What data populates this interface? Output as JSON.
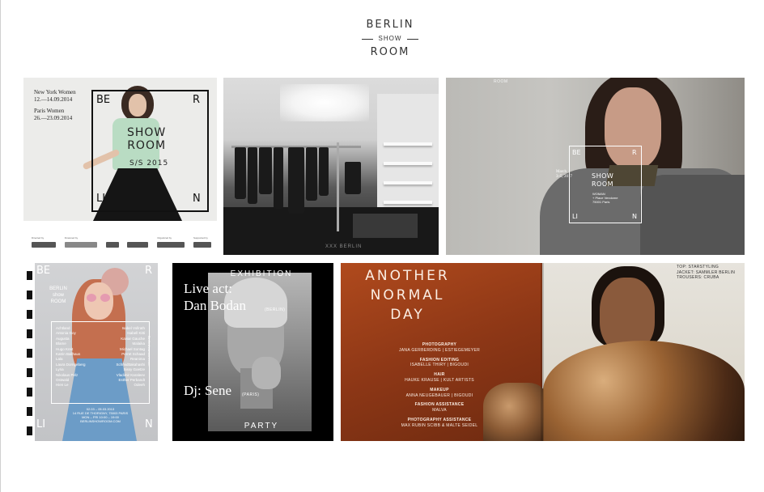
{
  "logo": {
    "line1": "BERLIN",
    "line2": "SHOW",
    "line3": "ROOM"
  },
  "tile1": {
    "dates": [
      "New York Women",
      "12.—14.09.2014",
      "",
      "Paris Women",
      "26.—23.09.2014"
    ],
    "corner_letters": [
      "BE",
      "R",
      "LI",
      "N"
    ],
    "show_lines": [
      "SHOW",
      "ROOM"
    ],
    "season": "S/S 2015",
    "sponsors": [
      {
        "caption": "Directed by",
        "label": "projekt"
      },
      {
        "caption": "Financed by",
        "label": "EU"
      },
      {
        "caption": "",
        "label": "BMWi"
      },
      {
        "caption": "",
        "label": "berlin"
      },
      {
        "caption": "Organized by",
        "label": "IDZ"
      },
      {
        "caption": "Supported by",
        "label": "logo"
      }
    ]
  },
  "tile2": {
    "watermark": "XXX BERLIN"
  },
  "tile3": {
    "tag": "ROOM",
    "corner_letters": [
      "BE",
      "R",
      "LI",
      "N"
    ],
    "show_lines": [
      "SHOW",
      "ROOM"
    ],
    "date_lines": [
      "March",
      "3–5, 2017"
    ],
    "sub_lines": [
      "WOMAN",
      "+ Place Vendome",
      "75001 Paris"
    ]
  },
  "tile4": {
    "corner_letters": [
      "BE",
      "R",
      "LI",
      "N"
    ],
    "logo_lines": [
      "BERLIN",
      "show",
      "ROOM"
    ],
    "list": [
      [
        "Achtland",
        "Isabel Vollrath"
      ],
      [
        "Antonia Goy",
        "Isabell Kitti"
      ],
      [
        "Augusta",
        "Kaviar Gauche"
      ],
      [
        "Blame",
        "Malaika"
      ],
      [
        "Hugo Kreit",
        "Michael Sontag"
      ],
      [
        "Katrin Ballhaus",
        "Perret Schaad"
      ],
      [
        "Lala",
        "Reanima"
      ],
      [
        "Laura Dorngeberg",
        "Schmidttakahashi"
      ],
      [
        "Lyria",
        "Sissy Goetze"
      ],
      [
        "Nikolaus Pelz",
        "Vladimir Karaleev"
      ],
      [
        "Ostwald",
        "Esther Perbandt"
      ],
      [
        "Hien Le",
        "Odeeh"
      ]
    ],
    "vertical": "Berlinshowroom.com",
    "info_lines": [
      "02.03 – 05.03.2013",
      "14 RUE DE THORIGNY, 75003 PARIS",
      "MON – FRI 10:00 – 19:00",
      "BERLINSHOWROOM.COM"
    ]
  },
  "tile5": {
    "top_word": "EXHIBITION",
    "bottom_word": "PARTY",
    "line1": "Live act:",
    "line2": "Dan Bodan",
    "line2_small": "(BERLIN)",
    "line3": "Dj: Sene",
    "line3_small": "(PARIS)"
  },
  "tile6": {
    "title_lines": [
      "ANOTHER",
      "NORMAL",
      "DAY"
    ],
    "credits": [
      {
        "h": "PHOTOGRAPHY",
        "v": "JANA GERBERDING | ESTIEGEMEYER"
      },
      {
        "h": "FASHION EDITING",
        "v": "ISABELLE THIRY | BIGOUDI"
      },
      {
        "h": "HAIR",
        "v": "HAUKE KRAUSE | KULT ARTISTS"
      },
      {
        "h": "MAKEUP",
        "v": "ANNA NEUGEBAUER | BIGOUDI"
      },
      {
        "h": "FASHION ASSISTANCE",
        "v": "MALVA"
      },
      {
        "h": "PHOTOGRAPHY ASSISTANCE",
        "v": "MAX RUBIN SCIBB & MALTE SEIDEL"
      }
    ],
    "styling": [
      "TOP: STARSTYLING",
      "JACKET: SAMMLER BERLIN",
      "TROUSERS: CRUBA"
    ]
  }
}
